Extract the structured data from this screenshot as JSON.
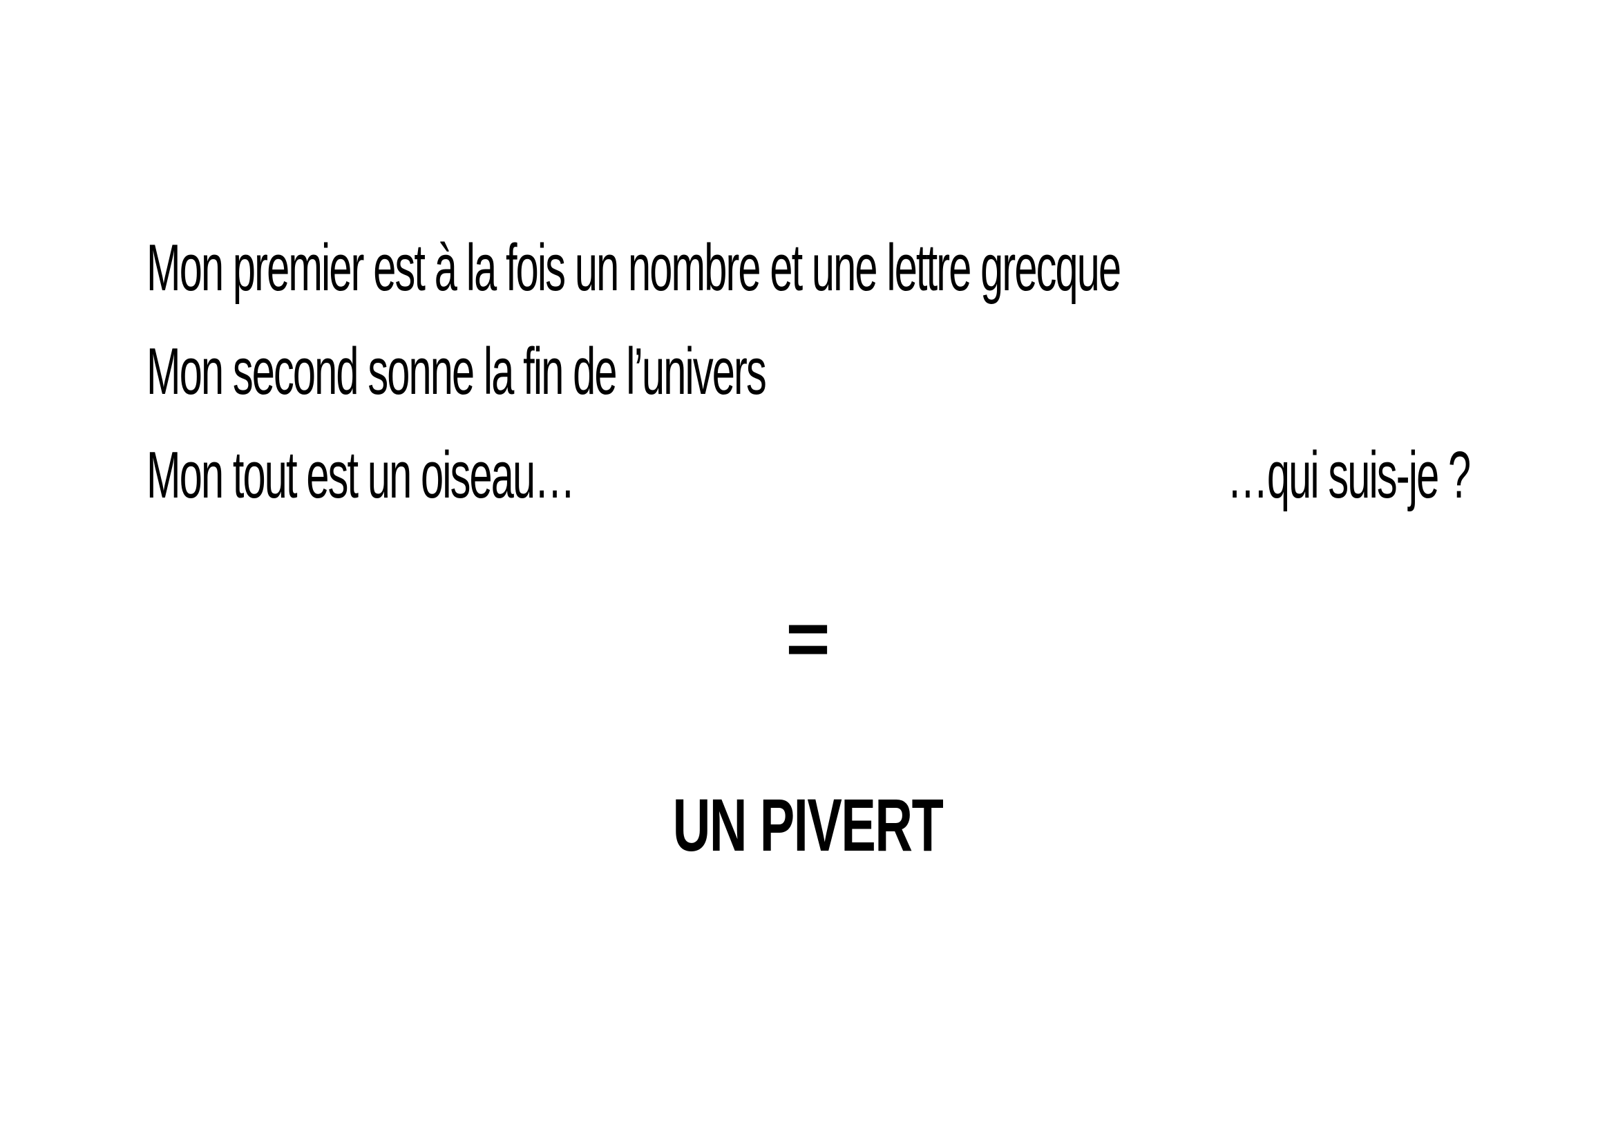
{
  "riddle": {
    "line1": "Mon premier est à la fois un nombre et une lettre grecque",
    "line2": "Mon second sonne la fin de l’univers",
    "line3": "Mon tout est un oiseau…",
    "question": "…qui suis-je ?"
  },
  "equals": "=",
  "answer": "UN PIVERT"
}
